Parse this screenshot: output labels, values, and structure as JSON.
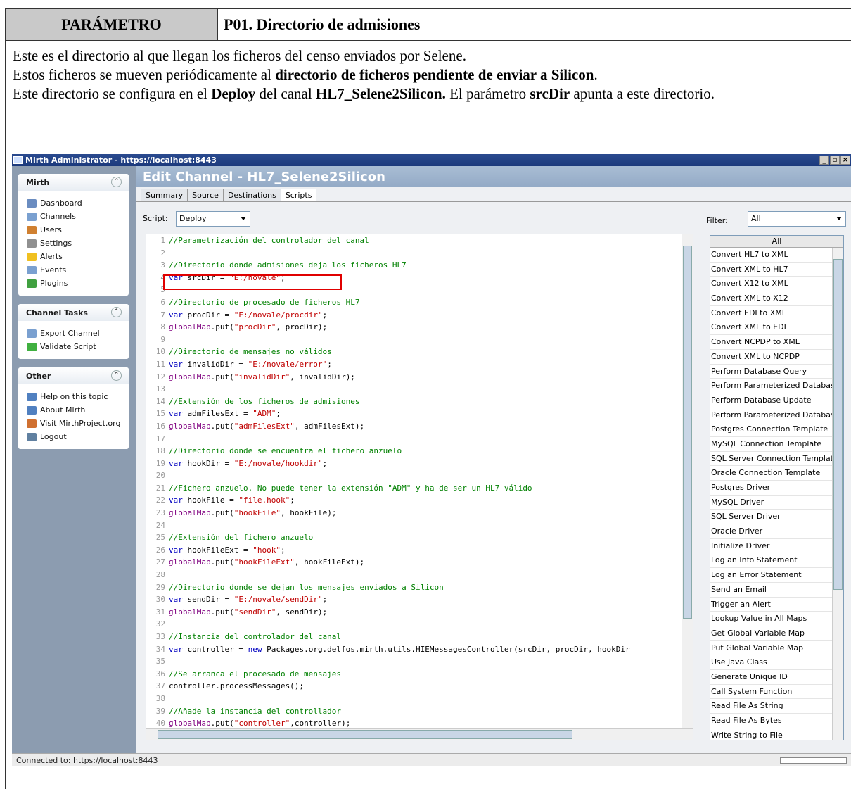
{
  "doc": {
    "param_label": "PARÁMETRO",
    "param_value": "P01. Directorio de admisiones",
    "lines": [
      [
        "Este es el directorio al que llegan los ficheros del censo enviados por Selene."
      ],
      [
        "Estos ficheros se mueven periódicamente al ",
        "directorio de ficheros pendiente de enviar a Silicon",
        "."
      ],
      [
        "Este directorio se configura en el ",
        "Deploy",
        " del canal ",
        "HL7_Selene2Silicon.",
        " El parámetro ",
        "srcDir",
        " apunta a este directorio."
      ]
    ]
  },
  "window": {
    "title": "Mirth Administrator - https://localhost:8443",
    "controls": [
      "_",
      "▫",
      "×"
    ]
  },
  "sidebar": {
    "panels": [
      {
        "title": "Mirth",
        "items": [
          {
            "label": "Dashboard",
            "icon": "dashboard-icon",
            "color": "#6a8cc0"
          },
          {
            "label": "Channels",
            "icon": "channels-icon",
            "color": "#7aa0d0"
          },
          {
            "label": "Users",
            "icon": "users-icon",
            "color": "#d08030"
          },
          {
            "label": "Settings",
            "icon": "settings-icon",
            "color": "#909090"
          },
          {
            "label": "Alerts",
            "icon": "alerts-icon",
            "color": "#f0c020"
          },
          {
            "label": "Events",
            "icon": "events-icon",
            "color": "#7aa0d0"
          },
          {
            "label": "Plugins",
            "icon": "plugins-icon",
            "color": "#40a040"
          }
        ]
      },
      {
        "title": "Channel Tasks",
        "items": [
          {
            "label": "Export Channel",
            "icon": "export-channel-icon",
            "color": "#7aa0d0"
          },
          {
            "label": "Validate Script",
            "icon": "validate-script-icon",
            "color": "#40b040"
          }
        ]
      },
      {
        "title": "Other",
        "items": [
          {
            "label": "Help on this topic",
            "icon": "help-icon",
            "color": "#5080c0"
          },
          {
            "label": "About Mirth",
            "icon": "about-icon",
            "color": "#5080c0"
          },
          {
            "label": "Visit MirthProject.org",
            "icon": "home-icon",
            "color": "#d07030"
          },
          {
            "label": "Logout",
            "icon": "logout-icon",
            "color": "#6080a0"
          }
        ]
      }
    ]
  },
  "main": {
    "title": "Edit Channel - HL7_Selene2Silicon",
    "tabs": [
      "Summary",
      "Source",
      "Destinations",
      "Scripts"
    ],
    "active_tab": "Scripts",
    "script_label": "Script:",
    "script_value": "Deploy",
    "filter_label": "Filter:",
    "filter_value": "All"
  },
  "code_lines": [
    [
      [
        "c-com",
        "//Parametrización del controlador del canal"
      ]
    ],
    [],
    [
      [
        "c-com",
        "//Directorio donde admisiones deja los ficheros HL7"
      ]
    ],
    [
      [
        "c-kw",
        "var"
      ],
      [
        "",
        " srcDir = "
      ],
      [
        "c-str",
        "\"E:/novale\""
      ],
      [
        "",
        ";"
      ]
    ],
    [],
    [
      [
        "c-com",
        "//Directorio de procesado de ficheros HL7"
      ]
    ],
    [
      [
        "c-kw",
        "var"
      ],
      [
        "",
        " procDir = "
      ],
      [
        "c-str",
        "\"E:/novale/procdir\""
      ],
      [
        "",
        ";"
      ]
    ],
    [
      [
        "c-fn",
        "globalMap"
      ],
      [
        "",
        ".put("
      ],
      [
        "c-str",
        "\"procDir\""
      ],
      [
        "",
        ", procDir);"
      ]
    ],
    [],
    [
      [
        "c-com",
        "//Directorio de mensajes no válidos"
      ]
    ],
    [
      [
        "c-kw",
        "var"
      ],
      [
        "",
        " invalidDir = "
      ],
      [
        "c-str",
        "\"E:/novale/error\""
      ],
      [
        "",
        ";"
      ]
    ],
    [
      [
        "c-fn",
        "globalMap"
      ],
      [
        "",
        ".put("
      ],
      [
        "c-str",
        "\"invalidDir\""
      ],
      [
        "",
        ", invalidDir);"
      ]
    ],
    [],
    [
      [
        "c-com",
        "//Extensión de los ficheros de admisiones"
      ]
    ],
    [
      [
        "c-kw",
        "var"
      ],
      [
        "",
        " admFilesExt = "
      ],
      [
        "c-str",
        "\"ADM\""
      ],
      [
        "",
        ";"
      ]
    ],
    [
      [
        "c-fn",
        "globalMap"
      ],
      [
        "",
        ".put("
      ],
      [
        "c-str",
        "\"admFilesExt\""
      ],
      [
        "",
        ", admFilesExt);"
      ]
    ],
    [],
    [
      [
        "c-com",
        "//Directorio donde se encuentra el fichero anzuelo"
      ]
    ],
    [
      [
        "c-kw",
        "var"
      ],
      [
        "",
        " hookDir = "
      ],
      [
        "c-str",
        "\"E:/novale/hookdir\""
      ],
      [
        "",
        ";"
      ]
    ],
    [],
    [
      [
        "c-com",
        "//Fichero anzuelo. No puede tener la extensión \"ADM\" y ha de ser un HL7 válido"
      ]
    ],
    [
      [
        "c-kw",
        "var"
      ],
      [
        "",
        " hookFile = "
      ],
      [
        "c-str",
        "\"file.hook\""
      ],
      [
        "",
        ";"
      ]
    ],
    [
      [
        "c-fn",
        "globalMap"
      ],
      [
        "",
        ".put("
      ],
      [
        "c-str",
        "\"hookFile\""
      ],
      [
        "",
        ", hookFile);"
      ]
    ],
    [],
    [
      [
        "c-com",
        "//Extensión del fichero anzuelo"
      ]
    ],
    [
      [
        "c-kw",
        "var"
      ],
      [
        "",
        " hookFileExt = "
      ],
      [
        "c-str",
        "\"hook\""
      ],
      [
        "",
        ";"
      ]
    ],
    [
      [
        "c-fn",
        "globalMap"
      ],
      [
        "",
        ".put("
      ],
      [
        "c-str",
        "\"hookFileExt\""
      ],
      [
        "",
        ", hookFileExt);"
      ]
    ],
    [],
    [
      [
        "c-com",
        "//Directorio donde se dejan los mensajes enviados a Silicon"
      ]
    ],
    [
      [
        "c-kw",
        "var"
      ],
      [
        "",
        " sendDir = "
      ],
      [
        "c-str",
        "\"E:/novale/sendDir\""
      ],
      [
        "",
        ";"
      ]
    ],
    [
      [
        "c-fn",
        "globalMap"
      ],
      [
        "",
        ".put("
      ],
      [
        "c-str",
        "\"sendDir\""
      ],
      [
        "",
        ", sendDir);"
      ]
    ],
    [],
    [
      [
        "c-com",
        "//Instancia del controlador del canal"
      ]
    ],
    [
      [
        "c-kw",
        "var"
      ],
      [
        "",
        " controller = "
      ],
      [
        "c-kw",
        "new"
      ],
      [
        "",
        " Packages.org.delfos.mirth.utils.HIEMessagesController(srcDir, procDir, hookDir"
      ]
    ],
    [],
    [
      [
        "c-com",
        "//Se arranca el procesado de mensajes"
      ]
    ],
    [
      [
        "",
        "controller.processMessages();"
      ]
    ],
    [],
    [
      [
        "c-com",
        "//Añade la instancia del controllador"
      ]
    ],
    [
      [
        "c-fn",
        "globalMap"
      ],
      [
        "",
        ".put("
      ],
      [
        "c-str",
        "\"controller\""
      ],
      [
        "",
        ",controller);"
      ]
    ]
  ],
  "function_list": {
    "header": "All",
    "items": [
      "Convert HL7 to XML",
      "Convert XML to HL7",
      "Convert X12 to XML",
      "Convert XML to X12",
      "Convert EDI to XML",
      "Convert XML to EDI",
      "Convert NCPDP to XML",
      "Convert XML to NCPDP",
      "Perform Database Query",
      "Perform Parameterized Database ...",
      "Perform Database Update",
      "Perform Parameterized Database ...",
      "Postgres Connection Template",
      "MySQL Connection Template",
      "SQL Server Connection Template",
      "Oracle Connection Template",
      "Postgres Driver",
      "MySQL Driver",
      "SQL Server Driver",
      "Oracle Driver",
      "Initialize Driver",
      "Log an Info Statement",
      "Log an Error Statement",
      "Send an Email",
      "Trigger an Alert",
      "Lookup Value in All Maps",
      "Get Global Variable Map",
      "Put Global Variable Map",
      "Use Java Class",
      "Generate Unique ID",
      "Call System Function",
      "Read File As String",
      "Read File As Bytes",
      "Write String to File"
    ]
  },
  "status": {
    "text": "Connected to: https://localhost:8443"
  }
}
